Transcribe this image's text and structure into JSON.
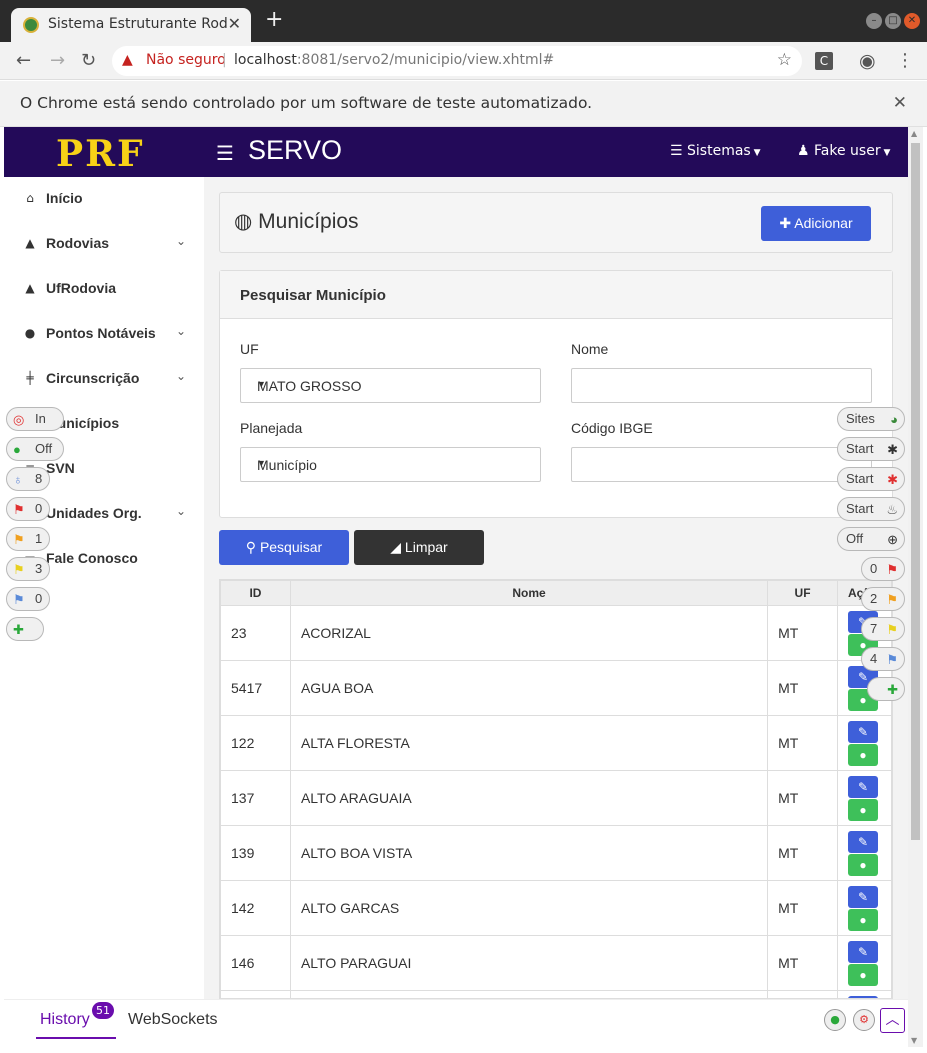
{
  "browser": {
    "tab_title": "Sistema Estruturante Rodoviário",
    "new_tab": "+",
    "security_label": "Não seguro",
    "url_host": "localhost",
    "url_rest": ":8081/servo2/municipio/view.xhtml#",
    "infobar_message": "O Chrome está sendo controlado por um software de teste automatizado."
  },
  "header": {
    "logo": "PRF",
    "title": "SERVO",
    "sistemas": "Sistemas",
    "user": "Fake user"
  },
  "sidebar": {
    "items": [
      {
        "label": "Início",
        "icon": "home-icon",
        "glyph": "⌂",
        "expandable": false
      },
      {
        "label": "Rodovias",
        "icon": "road-icon",
        "glyph": "▲",
        "expandable": true
      },
      {
        "label": "UfRodovia",
        "icon": "road-icon",
        "glyph": "▲",
        "expandable": false
      },
      {
        "label": "Pontos Notáveis",
        "icon": "map-marker-icon",
        "glyph": "●",
        "expandable": true
      },
      {
        "label": "Circunscrição",
        "icon": "signpost-icon",
        "glyph": "╪",
        "expandable": true
      },
      {
        "label": "Municípios",
        "icon": "globe-icon",
        "glyph": "◍",
        "expandable": false
      },
      {
        "label": "SVN",
        "icon": "code-icon",
        "glyph": "≡",
        "expandable": false
      },
      {
        "label": "Unidades Org.",
        "icon": "building-icon",
        "glyph": "▤",
        "expandable": true
      },
      {
        "label": "Fale Conosco",
        "icon": "envelope-icon",
        "glyph": "▬",
        "expandable": false
      }
    ]
  },
  "page": {
    "title": "Municípios",
    "add_button": "Adicionar"
  },
  "search": {
    "heading": "Pesquisar Município",
    "uf_label": "UF",
    "uf_value": "MATO GROSSO",
    "nome_label": "Nome",
    "nome_value": "",
    "planejada_label": "Planejada",
    "planejada_value": "Município",
    "ibge_label": "Código IBGE",
    "ibge_value": "",
    "search_button": "Pesquisar",
    "clear_button": "Limpar"
  },
  "table": {
    "headers": [
      "ID",
      "Nome",
      "UF",
      "Ações"
    ],
    "rows": [
      {
        "id": "23",
        "nome": "ACORIZAL",
        "uf": "MT"
      },
      {
        "id": "5417",
        "nome": "AGUA BOA",
        "uf": "MT"
      },
      {
        "id": "122",
        "nome": "ALTA FLORESTA",
        "uf": "MT"
      },
      {
        "id": "137",
        "nome": "ALTO ARAGUAIA",
        "uf": "MT"
      },
      {
        "id": "139",
        "nome": "ALTO BOA VISTA",
        "uf": "MT"
      },
      {
        "id": "142",
        "nome": "ALTO GARCAS",
        "uf": "MT"
      },
      {
        "id": "146",
        "nome": "ALTO PARAGUAI",
        "uf": "MT"
      },
      {
        "id": "",
        "nome": "",
        "uf": ""
      }
    ]
  },
  "bottom_bar": {
    "history_label": "History",
    "history_count": "51",
    "websockets_label": "WebSockets"
  },
  "left_pills": [
    {
      "text": "In",
      "icon": "target-icon",
      "glyph": "◎",
      "color": "#e03030"
    },
    {
      "text": "Off",
      "icon": "green-dot-icon",
      "glyph": "●",
      "color": "#2aa83a"
    },
    {
      "text": "8",
      "icon": "lightbulb-icon",
      "glyph": "♁",
      "color": "#6b8fd8"
    },
    {
      "text": "0",
      "icon": "red-flag-icon",
      "glyph": "⚑",
      "color": "#e03030"
    },
    {
      "text": "1",
      "icon": "orange-flag-icon",
      "glyph": "⚑",
      "color": "#f0a020"
    },
    {
      "text": "3",
      "icon": "yellow-flag-icon",
      "glyph": "⚑",
      "color": "#e8d020"
    },
    {
      "text": "0",
      "icon": "blue-flag-icon",
      "glyph": "⚑",
      "color": "#5a8ad8"
    },
    {
      "text": "",
      "icon": "plus-icon",
      "glyph": "✚",
      "color": "#2aa83a"
    }
  ],
  "right_pills": [
    {
      "text": "Sites",
      "icon": "globe-icon",
      "glyph": "◕",
      "color": "#3a8a3a"
    },
    {
      "text": "Start",
      "icon": "spider-icon",
      "glyph": "✱",
      "color": "#333333"
    },
    {
      "text": "Start",
      "icon": "red-spider-icon",
      "glyph": "✱",
      "color": "#e03030"
    },
    {
      "text": "Start",
      "icon": "flame-icon",
      "glyph": "♨",
      "color": "#555555"
    },
    {
      "text": "Off",
      "icon": "crosshair-icon",
      "glyph": "⊕",
      "color": "#333333"
    },
    {
      "text": "0",
      "icon": "red-flag-icon",
      "glyph": "⚑",
      "color": "#e03030"
    },
    {
      "text": "2",
      "icon": "orange-flag-icon",
      "glyph": "⚑",
      "color": "#f0a020"
    },
    {
      "text": "7",
      "icon": "yellow-flag-icon",
      "glyph": "⚑",
      "color": "#e8d020"
    },
    {
      "text": "4",
      "icon": "blue-flag-icon",
      "glyph": "⚑",
      "color": "#5a8ad8"
    },
    {
      "text": "",
      "icon": "plus-icon",
      "glyph": "✚",
      "color": "#2aa83a"
    }
  ],
  "colors": {
    "header_bg": "#230a59",
    "logo": "#f7d117",
    "primary": "#3e5fd9",
    "success": "#3ec05a",
    "dark": "#333333",
    "accent": "#6a0dad"
  }
}
